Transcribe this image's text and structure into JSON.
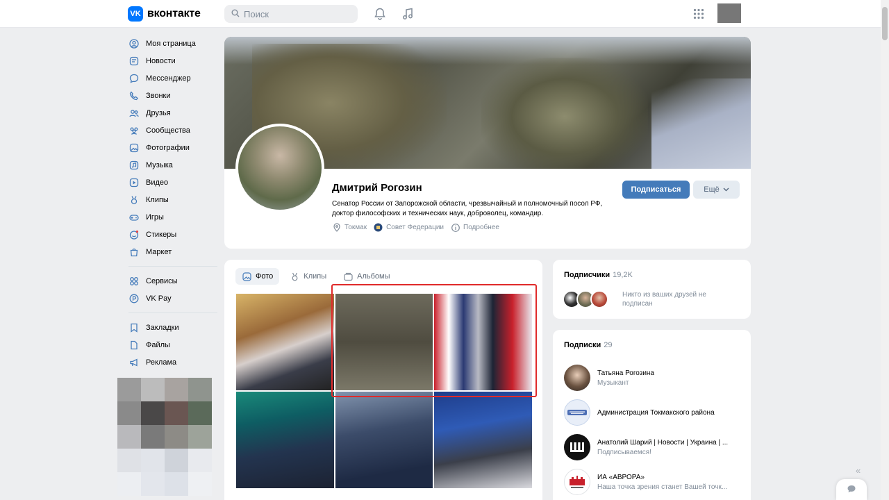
{
  "header": {
    "logo_text": "вконтакте",
    "search_placeholder": "Поиск"
  },
  "sidebar": {
    "items": [
      {
        "label": "Моя страница"
      },
      {
        "label": "Новости"
      },
      {
        "label": "Мессенджер"
      },
      {
        "label": "Звонки"
      },
      {
        "label": "Друзья"
      },
      {
        "label": "Сообщества"
      },
      {
        "label": "Фотографии"
      },
      {
        "label": "Музыка"
      },
      {
        "label": "Видео"
      },
      {
        "label": "Клипы"
      },
      {
        "label": "Игры"
      },
      {
        "label": "Стикеры"
      },
      {
        "label": "Маркет"
      },
      {
        "label": "Сервисы"
      },
      {
        "label": "VK Pay"
      },
      {
        "label": "Закладки"
      },
      {
        "label": "Файлы"
      },
      {
        "label": "Реклама"
      }
    ]
  },
  "profile": {
    "name": "Дмитрий Рогозин",
    "description": "Сенатор России от Запорожской области, чрезвычайный и полномочный посол РФ, доктор философских и технических наук, доброволец, командир.",
    "location": "Токмак",
    "org": "Совет Федерации",
    "more_label": "Подробнее",
    "subscribe_label": "Подписаться",
    "more_button_label": "Ещё"
  },
  "photos": {
    "tabs": [
      {
        "label": "Фото"
      },
      {
        "label": "Клипы"
      },
      {
        "label": "Альбомы"
      }
    ]
  },
  "subscribers": {
    "title": "Подписчики",
    "count": "19,2K",
    "note": "Никто из ваших друзей не подписан"
  },
  "subscriptions": {
    "title": "Подписки",
    "count": "29",
    "items": [
      {
        "name": "Татьяна Рогозина",
        "sub": "Музыкант"
      },
      {
        "name": "Администрация Токмакского района",
        "sub": ""
      },
      {
        "name": "Анатолий Шарий | Новости | Украина | ...",
        "sub": "Подписываемся!"
      },
      {
        "name": "ИА «АВРОРА»",
        "sub": "Наша точка зрения станет Вашей точк..."
      }
    ]
  },
  "colors": {
    "accent": "#447bba",
    "brand": "#0077ff",
    "highlight": "#e02b2b"
  }
}
